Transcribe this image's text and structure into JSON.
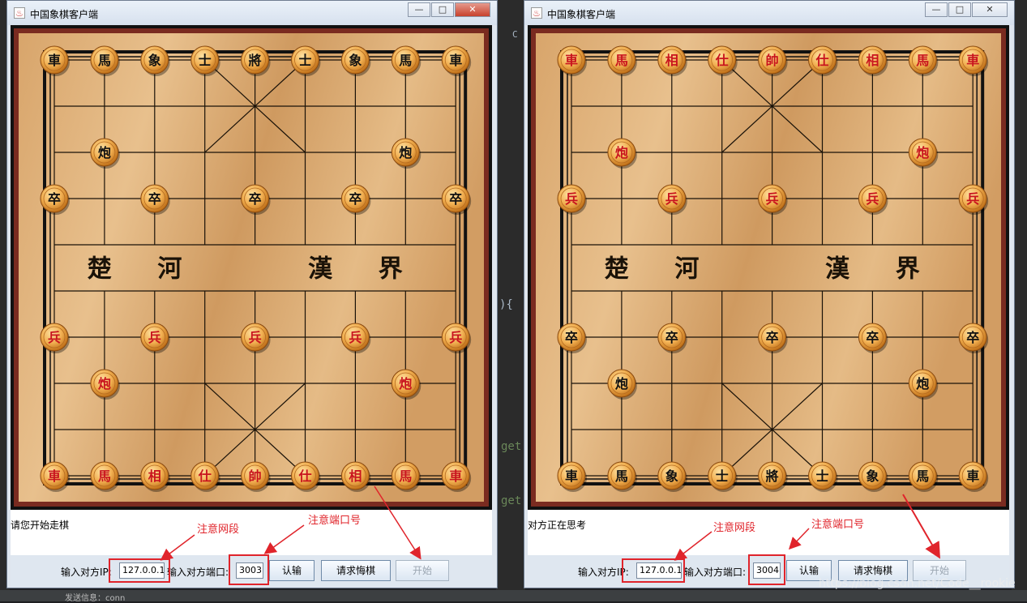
{
  "windows": [
    {
      "title": "中国象棋客户端",
      "status_message": "请您开始走棋",
      "ip_label": "输入对方IP:",
      "ip_value": "127.0.0.1",
      "port_label": "输入对方端口:",
      "port_value": "3003",
      "buttons": {
        "resign": "认输",
        "undo": "请求悔棋",
        "start": "开始"
      },
      "annotations": {
        "network": "注意网段",
        "port": "注意端口号"
      },
      "river": [
        "楚",
        "河",
        "漢",
        "界"
      ],
      "pieces": [
        {
          "col": 0,
          "row": 0,
          "ch": "車",
          "side": "black"
        },
        {
          "col": 1,
          "row": 0,
          "ch": "馬",
          "side": "black"
        },
        {
          "col": 2,
          "row": 0,
          "ch": "象",
          "side": "black"
        },
        {
          "col": 3,
          "row": 0,
          "ch": "士",
          "side": "black"
        },
        {
          "col": 4,
          "row": 0,
          "ch": "將",
          "side": "black"
        },
        {
          "col": 5,
          "row": 0,
          "ch": "士",
          "side": "black"
        },
        {
          "col": 6,
          "row": 0,
          "ch": "象",
          "side": "black"
        },
        {
          "col": 7,
          "row": 0,
          "ch": "馬",
          "side": "black"
        },
        {
          "col": 8,
          "row": 0,
          "ch": "車",
          "side": "black"
        },
        {
          "col": 1,
          "row": 2,
          "ch": "炮",
          "side": "black"
        },
        {
          "col": 7,
          "row": 2,
          "ch": "炮",
          "side": "black"
        },
        {
          "col": 0,
          "row": 3,
          "ch": "卒",
          "side": "black"
        },
        {
          "col": 2,
          "row": 3,
          "ch": "卒",
          "side": "black"
        },
        {
          "col": 4,
          "row": 3,
          "ch": "卒",
          "side": "black"
        },
        {
          "col": 6,
          "row": 3,
          "ch": "卒",
          "side": "black"
        },
        {
          "col": 8,
          "row": 3,
          "ch": "卒",
          "side": "black"
        },
        {
          "col": 0,
          "row": 6,
          "ch": "兵",
          "side": "red"
        },
        {
          "col": 2,
          "row": 6,
          "ch": "兵",
          "side": "red"
        },
        {
          "col": 4,
          "row": 6,
          "ch": "兵",
          "side": "red"
        },
        {
          "col": 6,
          "row": 6,
          "ch": "兵",
          "side": "red"
        },
        {
          "col": 8,
          "row": 6,
          "ch": "兵",
          "side": "red"
        },
        {
          "col": 1,
          "row": 7,
          "ch": "炮",
          "side": "red"
        },
        {
          "col": 7,
          "row": 7,
          "ch": "炮",
          "side": "red"
        },
        {
          "col": 0,
          "row": 9,
          "ch": "車",
          "side": "red"
        },
        {
          "col": 1,
          "row": 9,
          "ch": "馬",
          "side": "red"
        },
        {
          "col": 2,
          "row": 9,
          "ch": "相",
          "side": "red"
        },
        {
          "col": 3,
          "row": 9,
          "ch": "仕",
          "side": "red"
        },
        {
          "col": 4,
          "row": 9,
          "ch": "帥",
          "side": "red"
        },
        {
          "col": 5,
          "row": 9,
          "ch": "仕",
          "side": "red"
        },
        {
          "col": 6,
          "row": 9,
          "ch": "相",
          "side": "red"
        },
        {
          "col": 7,
          "row": 9,
          "ch": "馬",
          "side": "red"
        },
        {
          "col": 8,
          "row": 9,
          "ch": "車",
          "side": "red"
        }
      ]
    },
    {
      "title": "中国象棋客户端",
      "status_message": "对方正在思考",
      "ip_label": "输入对方IP:",
      "ip_value": "127.0.0.1",
      "port_label": "输入对方端口:",
      "port_value": "3004",
      "buttons": {
        "resign": "认输",
        "undo": "请求悔棋",
        "start": "开始"
      },
      "annotations": {
        "network": "注意网段",
        "port": "注意端口号"
      },
      "river": [
        "楚",
        "河",
        "漢",
        "界"
      ],
      "pieces": [
        {
          "col": 0,
          "row": 0,
          "ch": "車",
          "side": "red"
        },
        {
          "col": 1,
          "row": 0,
          "ch": "馬",
          "side": "red"
        },
        {
          "col": 2,
          "row": 0,
          "ch": "相",
          "side": "red"
        },
        {
          "col": 3,
          "row": 0,
          "ch": "仕",
          "side": "red"
        },
        {
          "col": 4,
          "row": 0,
          "ch": "帥",
          "side": "red"
        },
        {
          "col": 5,
          "row": 0,
          "ch": "仕",
          "side": "red"
        },
        {
          "col": 6,
          "row": 0,
          "ch": "相",
          "side": "red"
        },
        {
          "col": 7,
          "row": 0,
          "ch": "馬",
          "side": "red"
        },
        {
          "col": 8,
          "row": 0,
          "ch": "車",
          "side": "red"
        },
        {
          "col": 1,
          "row": 2,
          "ch": "炮",
          "side": "red"
        },
        {
          "col": 7,
          "row": 2,
          "ch": "炮",
          "side": "red"
        },
        {
          "col": 0,
          "row": 3,
          "ch": "兵",
          "side": "red"
        },
        {
          "col": 2,
          "row": 3,
          "ch": "兵",
          "side": "red"
        },
        {
          "col": 4,
          "row": 3,
          "ch": "兵",
          "side": "red"
        },
        {
          "col": 6,
          "row": 3,
          "ch": "兵",
          "side": "red"
        },
        {
          "col": 8,
          "row": 3,
          "ch": "兵",
          "side": "red"
        },
        {
          "col": 0,
          "row": 6,
          "ch": "卒",
          "side": "black"
        },
        {
          "col": 2,
          "row": 6,
          "ch": "卒",
          "side": "black"
        },
        {
          "col": 4,
          "row": 6,
          "ch": "卒",
          "side": "black"
        },
        {
          "col": 6,
          "row": 6,
          "ch": "卒",
          "side": "black"
        },
        {
          "col": 8,
          "row": 6,
          "ch": "卒",
          "side": "black"
        },
        {
          "col": 1,
          "row": 7,
          "ch": "炮",
          "side": "black"
        },
        {
          "col": 7,
          "row": 7,
          "ch": "炮",
          "side": "black"
        },
        {
          "col": 0,
          "row": 9,
          "ch": "車",
          "side": "black"
        },
        {
          "col": 1,
          "row": 9,
          "ch": "馬",
          "side": "black"
        },
        {
          "col": 2,
          "row": 9,
          "ch": "象",
          "side": "black"
        },
        {
          "col": 3,
          "row": 9,
          "ch": "士",
          "side": "black"
        },
        {
          "col": 4,
          "row": 9,
          "ch": "將",
          "side": "black"
        },
        {
          "col": 5,
          "row": 9,
          "ch": "士",
          "side": "black"
        },
        {
          "col": 6,
          "row": 9,
          "ch": "象",
          "side": "black"
        },
        {
          "col": 7,
          "row": 9,
          "ch": "馬",
          "side": "black"
        },
        {
          "col": 8,
          "row": 9,
          "ch": "車",
          "side": "black"
        }
      ]
    }
  ],
  "background": {
    "ide_fragments": [
      "C",
      "){",
      "get",
      "get"
    ],
    "status_text": "发送信息：conn"
  },
  "watermark": "https://blog.csdn.net/Code__rookie",
  "colors": {
    "red_piece_text": "#c8141e",
    "black_piece_text": "#111111",
    "annotation": "#e0242b"
  }
}
